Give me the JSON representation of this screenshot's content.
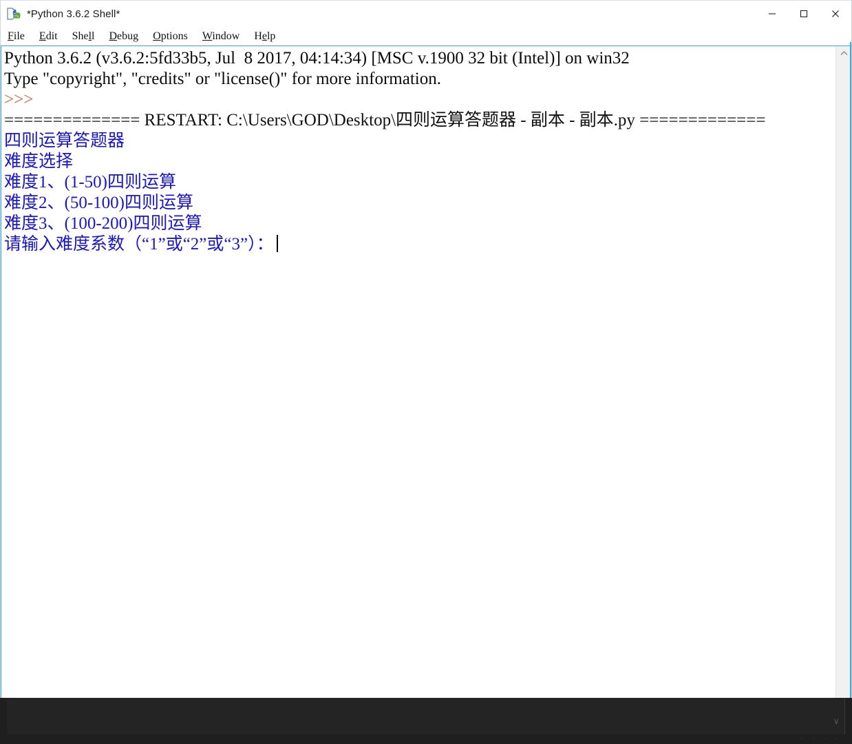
{
  "window": {
    "title": "*Python 3.6.2 Shell*",
    "icon": "python-idle-icon",
    "controls": {
      "minimize": "minimize-icon",
      "maximize": "maximize-icon",
      "close": "close-icon"
    }
  },
  "menubar": {
    "items": [
      {
        "accel": "F",
        "rest": "ile"
      },
      {
        "accel": "E",
        "rest": "dit"
      },
      {
        "pre": "She",
        "accel": "l",
        "rest": "l"
      },
      {
        "accel": "D",
        "rest": "ebug"
      },
      {
        "accel": "O",
        "rest": "ptions"
      },
      {
        "accel": "W",
        "rest": "indow"
      },
      {
        "pre": "H",
        "accel": "e",
        "rest": "lp"
      }
    ]
  },
  "shell": {
    "lines": [
      {
        "kind": "stdout",
        "text": "Python 3.6.2 (v3.6.2:5fd33b5, Jul  8 2017, 04:14:34) [MSC v.1900 32 bit (Intel)] on win32"
      },
      {
        "kind": "stdout",
        "text": "Type \"copyright\", \"credits\" or \"license()\" for more information."
      },
      {
        "kind": "prompt",
        "text": ">>> "
      },
      {
        "kind": "restart",
        "text": "============== RESTART: C:\\Users\\GOD\\Desktop\\四则运算答题器 - 副本 - 副本.py ============="
      },
      {
        "kind": "blue",
        "text": "四则运算答题器"
      },
      {
        "kind": "blue",
        "text": "难度选择"
      },
      {
        "kind": "blue",
        "text": "难度1、(1-50)四则运算"
      },
      {
        "kind": "blue",
        "text": "难度2、(50-100)四则运算"
      },
      {
        "kind": "blue",
        "text": "难度3、(100-200)四则运算"
      },
      {
        "kind": "blue",
        "text": "请输入难度系数（“1”或“2”或“3”）：",
        "caret": true
      }
    ],
    "input_value": "",
    "scrollbar": {
      "up_arrow": "chevron-up-icon",
      "down_arrow": "chevron-down-icon"
    }
  },
  "taskbar": {
    "tray_chevron": "∨",
    "dots": "· · · ·"
  },
  "colors": {
    "stdout": "#0b0b0b",
    "prompt": "#c06a44",
    "program_output": "#1a16c8",
    "border_focus": "#3da5e8",
    "taskbar_bg": "#1f1f1f"
  }
}
